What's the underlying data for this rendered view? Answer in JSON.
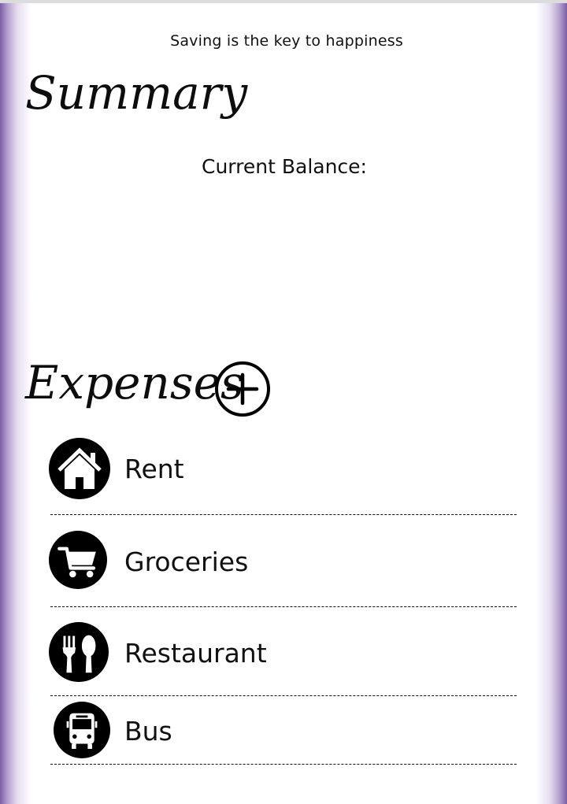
{
  "header": {
    "tagline": "Saving is the key to happiness"
  },
  "summary": {
    "title": "Summary",
    "balance_label": "Current Balance:"
  },
  "expenses": {
    "title": "Expenses",
    "add_icon": "plus-circle-icon",
    "items": [
      {
        "label": "Rent",
        "icon": "house-icon"
      },
      {
        "label": "Groceries",
        "icon": "shopping-cart-icon"
      },
      {
        "label": "Restaurant",
        "icon": "fork-spoon-icon"
      },
      {
        "label": "Bus",
        "icon": "bus-icon"
      }
    ]
  },
  "theme": {
    "accent": "#7a5ea5",
    "text": "#111111",
    "background": "#ffffff"
  }
}
